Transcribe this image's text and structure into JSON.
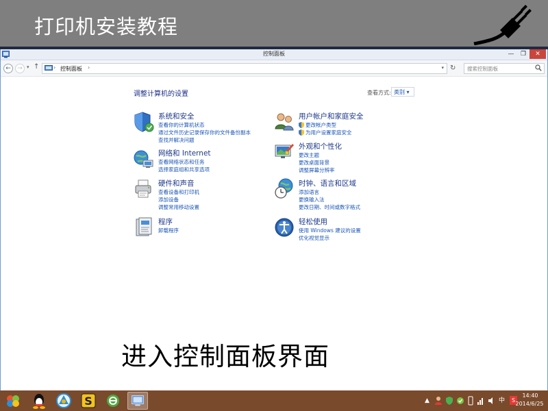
{
  "slide": {
    "title": "打印机安装教程",
    "caption": "进入控制面板界面"
  },
  "window": {
    "title": "控制面板",
    "minimize": "—",
    "maximize": "❐",
    "close": "✕"
  },
  "address_bar": {
    "back": "←",
    "forward": "→",
    "up": "↑",
    "dropdown": "▾",
    "path": "控制面板",
    "path_separator": "›",
    "refresh": "↻",
    "search_placeholder": "搜索控制面板"
  },
  "content": {
    "heading": "调整计算机的设置",
    "view_by_label": "查看方式:",
    "view_by_value": "类别 ▾"
  },
  "categories": [
    {
      "icon": "shield-icon",
      "title": "系统和安全",
      "links": [
        "查看你的计算机状态",
        "通过文件历史记录保存你的文件备份副本",
        "查找并解决问题"
      ]
    },
    {
      "icon": "network-icon",
      "title": "网络和 Internet",
      "links": [
        "查看网络状态和任务",
        "选择家庭组和共享选项"
      ]
    },
    {
      "icon": "printer-icon",
      "title": "硬件和声音",
      "links": [
        "查看设备和打印机",
        "添加设备",
        "调整常用移动设置"
      ]
    },
    {
      "icon": "programs-icon",
      "title": "程序",
      "links": [
        "卸载程序"
      ]
    },
    {
      "icon": "users-icon",
      "title": "用户帐户和家庭安全",
      "links": [
        "更改帐户类型",
        "为用户设置家庭安全"
      ]
    },
    {
      "icon": "appearance-icon",
      "title": "外观和个性化",
      "links": [
        "更改主题",
        "更改桌面背景",
        "调整屏幕分辨率"
      ]
    },
    {
      "icon": "clock-globe-icon",
      "title": "时钟、语言和区域",
      "links": [
        "添加语言",
        "更换输入法",
        "更改日期、时间或数字格式"
      ]
    },
    {
      "icon": "ease-of-access-icon",
      "title": "轻松使用",
      "links": [
        "使用 Windows 建议的设置",
        "优化视觉显示"
      ]
    }
  ],
  "taskbar": {
    "apps": [
      "start-icon",
      "qq-icon",
      "browser-icon",
      "sogou-icon",
      "ie-icon",
      "control-panel-icon"
    ],
    "tray": [
      "▲",
      "中",
      "S"
    ],
    "time": "14:40",
    "date": "2014/6/25"
  },
  "colors": {
    "header_bg": "#7f7f7f",
    "link": "#1a55b5",
    "category_title": "#1e3a8a",
    "taskbar": "#7a4a2c"
  }
}
